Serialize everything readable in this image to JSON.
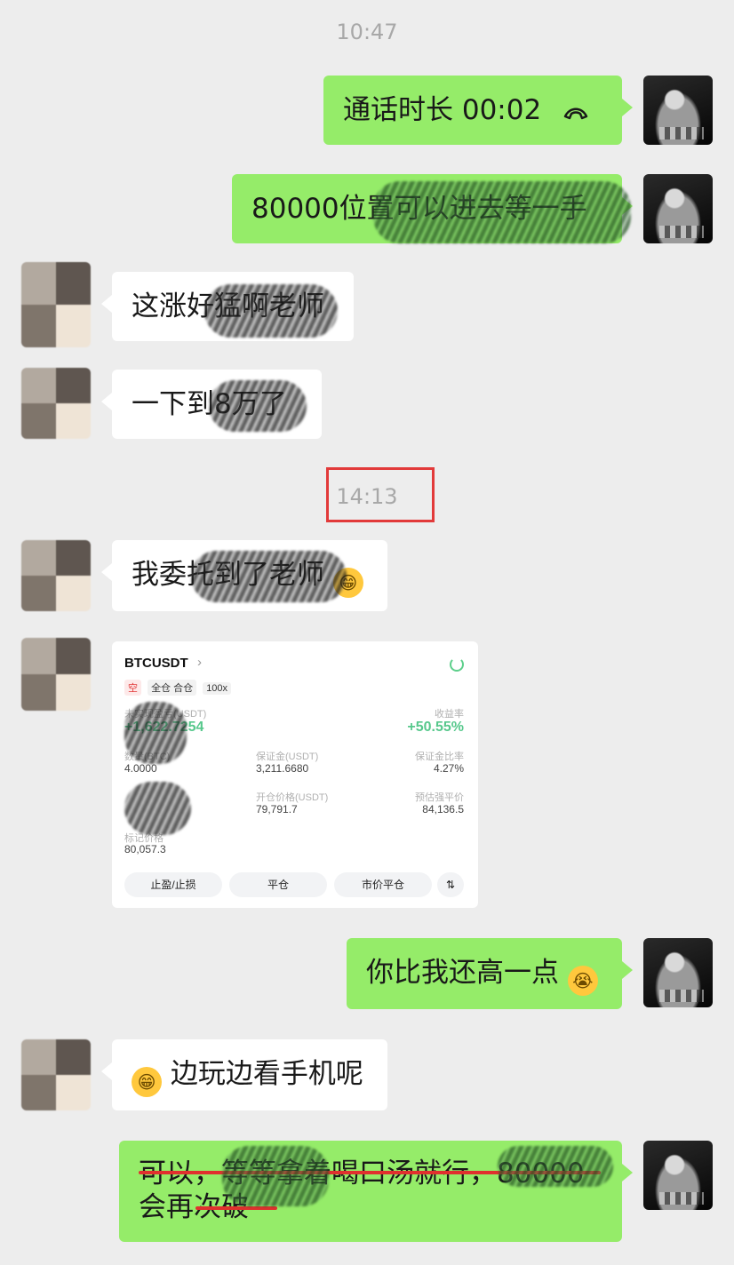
{
  "timestamps": [
    "10:47",
    "14:13"
  ],
  "messages": [
    {
      "side": "self",
      "text": "通话时长 00:02",
      "icon": "hang-up-phone-icon"
    },
    {
      "side": "self",
      "text": "80000位置可以进去等一手"
    },
    {
      "side": "other",
      "text": "这涨好猛啊老师"
    },
    {
      "side": "other",
      "text": "一下到8万了"
    },
    {
      "side": "other",
      "text": "我委托到了老师",
      "emoji": "grinning-face-icon"
    },
    {
      "side": "self",
      "text": "你比我还高一点",
      "emoji": "loudly-crying-face-icon"
    },
    {
      "side": "other",
      "text": "边玩边看手机呢",
      "emoji": "grinning-face-icon"
    },
    {
      "side": "self",
      "line1": "可以，等等拿着喝口汤就行，80000",
      "line2": "会再次破"
    }
  ],
  "card": {
    "symbol": "BTCUSDT",
    "tags": [
      "空",
      "全仓 合仓",
      "100x"
    ],
    "pnl_label": "未实现盈亏(USDT)",
    "pnl_value": "+1,622.7254",
    "roe_label": "收益率",
    "roe_value": "+50.55%",
    "qty_label": "数量(BTC)",
    "qty_value": "4.0000",
    "margin_label": "保证金(USDT)",
    "margin_value": "3,211.6680",
    "maint_label": "保证金比率",
    "maint_value": "4.27%",
    "entry_label": "开仓价格(USDT)",
    "entry_value": "79,791.7",
    "liq_label": "预估强平价",
    "liq_value": "84,136.5",
    "mark_label": "标记价格",
    "mark_value": "80,057.3",
    "buttons": [
      "止盈/止损",
      "平仓",
      "市价平仓"
    ]
  },
  "colors": {
    "self_bubble": "#95ec69",
    "other_bubble": "#ffffff",
    "background": "#ededed",
    "highlight": "#e23a3a"
  }
}
